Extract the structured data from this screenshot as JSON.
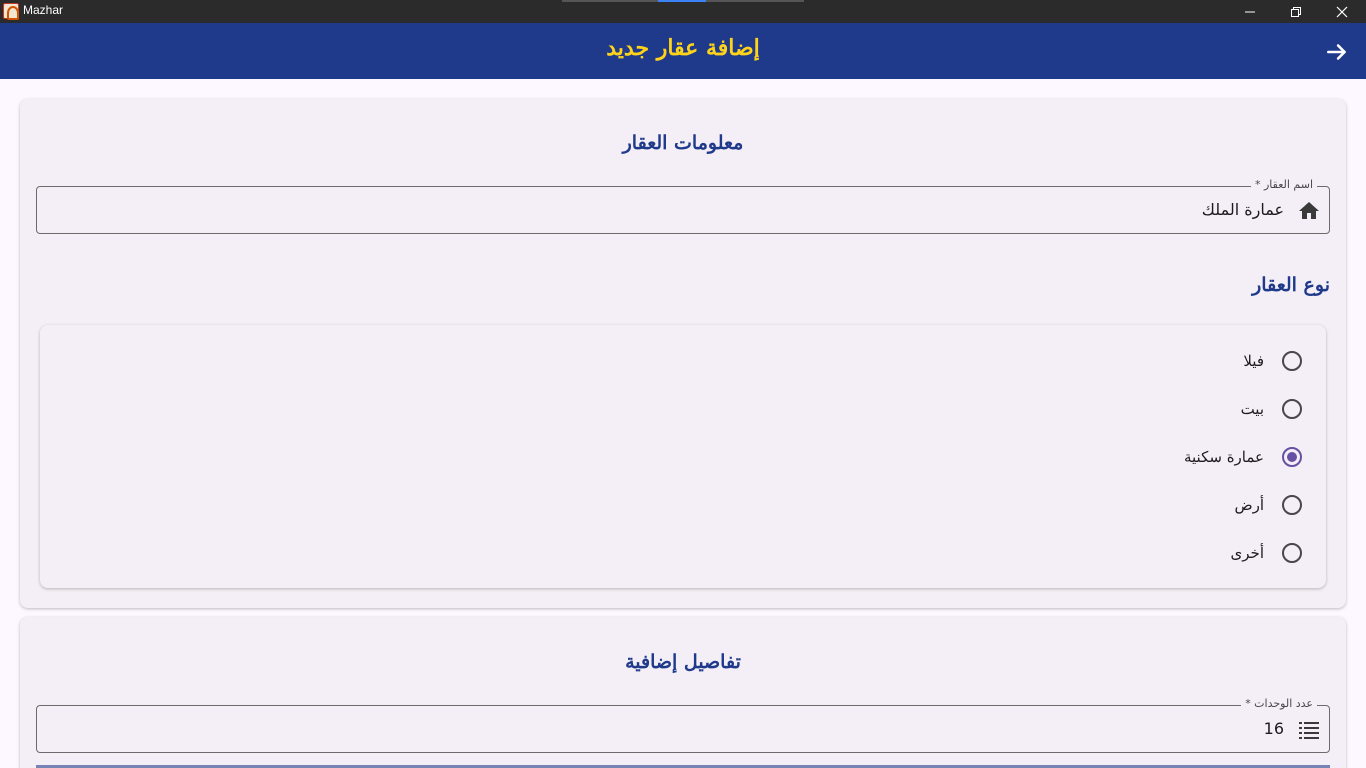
{
  "window": {
    "title": "Mazhar"
  },
  "appbar": {
    "title": "إضافة عقار جديد"
  },
  "property_info": {
    "section_title": "معلومات العقار",
    "name_field": {
      "label": "اسم العقار *",
      "value": "عمارة الملك",
      "icon": "home-icon"
    },
    "type_title": "نوع العقار",
    "types": [
      {
        "label": "فيلا",
        "selected": false
      },
      {
        "label": "بيت",
        "selected": false
      },
      {
        "label": "عمارة سكنية",
        "selected": true
      },
      {
        "label": "أرض",
        "selected": false
      },
      {
        "label": "أخرى",
        "selected": false
      }
    ]
  },
  "additional": {
    "section_title": "تفاصيل إضافية",
    "units_field": {
      "label": "عدد الوحدات *",
      "value": "16",
      "icon": "list-icon"
    }
  },
  "colors": {
    "primary": "#1f3a8a",
    "accent": "#ffd31a",
    "radio_selected": "#6750a4"
  }
}
